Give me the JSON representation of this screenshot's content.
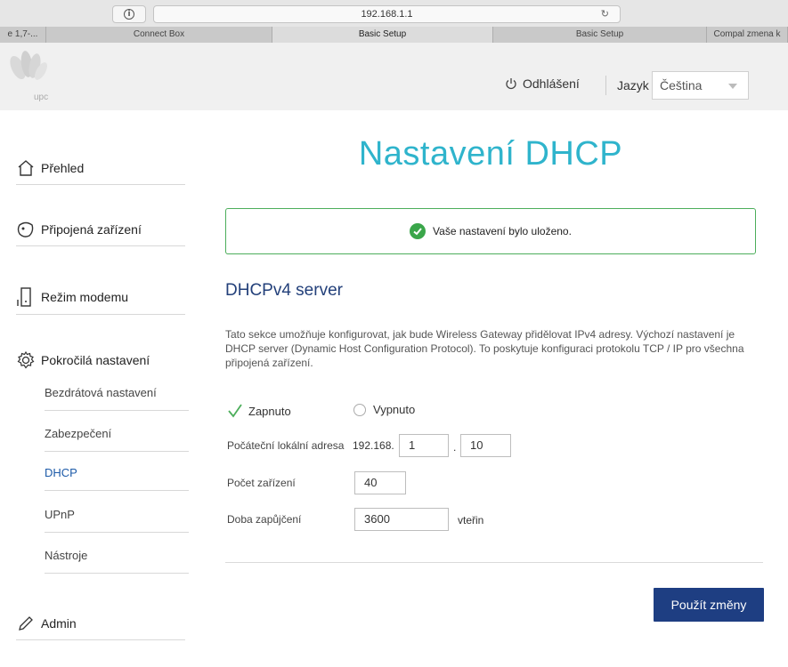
{
  "browser": {
    "url": "192.168.1.1",
    "tabs": [
      "e 1,7-...",
      "Connect Box",
      "Basic Setup",
      "Basic Setup",
      "Compal zmena k"
    ]
  },
  "header": {
    "logo_text": "upc",
    "logout_label": "Odhlášení",
    "language_label": "Jazyk",
    "language_value": "Čeština"
  },
  "sidebar": {
    "items": [
      {
        "label": "Přehled"
      },
      {
        "label": "Připojená zařízení"
      },
      {
        "label": "Režim modemu"
      },
      {
        "label": "Pokročilá nastavení"
      },
      {
        "label": "Admin"
      }
    ],
    "sub_items": [
      {
        "label": "Bezdrátová nastavení"
      },
      {
        "label": "Zabezpečení"
      },
      {
        "label": "DHCP"
      },
      {
        "label": "UPnP"
      },
      {
        "label": "Nástroje"
      }
    ],
    "active_sub_item": "DHCP"
  },
  "main": {
    "title": "Nastavení DHCP",
    "alert": "Vaše nastavení bylo uloženo.",
    "section_title": "DHCPv4 server",
    "description": "Tato sekce umožňuje konfigurovat, jak bude Wireless Gateway přidělovat IPv4 adresy. Výchozí nastavení je DHCP server (Dynamic Host Configuration Protocol). To poskytuje konfiguraci protokolu TCP / IP pro všechna připojená zařízení.",
    "radio_on_label": "Zapnuto",
    "radio_off_label": "Vypnuto",
    "radio_selected": "Zapnuto",
    "start_address_label": "Počáteční lokální adresa",
    "start_address_prefix": "192.168.",
    "start_address_octet3": "1",
    "start_address_dot": ".",
    "start_address_octet4": "10",
    "device_count_label": "Počet zařízení",
    "device_count_value": "40",
    "lease_time_label": "Doba zapůjčení",
    "lease_time_value": "3600",
    "lease_time_unit": "vteřin",
    "apply_button": "Použít změny"
  },
  "colors": {
    "title": "#2fb4cc",
    "section_title": "#23407a",
    "active_link": "#1c5aa8",
    "success": "#4cae5b",
    "button": "#1e3e82"
  }
}
